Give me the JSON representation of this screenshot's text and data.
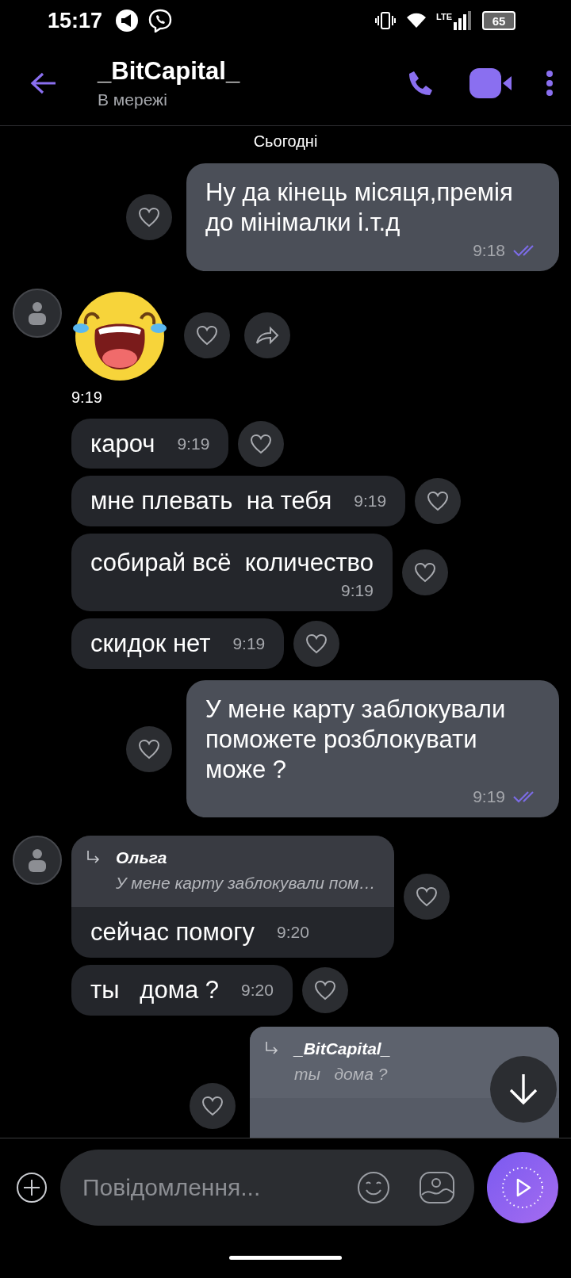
{
  "status_bar": {
    "time": "15:17",
    "network": "LTE",
    "battery": "65"
  },
  "header": {
    "title": "_BitCapital_",
    "subtitle": "В мережі"
  },
  "date_label": "Сьогодні",
  "messages": [
    {
      "kind": "text",
      "outgoing": true,
      "text": "Ну да кінець місяця,премія до мінімалки і.т.д",
      "time": "9:18",
      "read": true
    },
    {
      "kind": "sticker",
      "avatar": true,
      "time": "9:19"
    },
    {
      "kind": "text",
      "outgoing": false,
      "avatar": false,
      "text": "кароч",
      "time": "9:19",
      "time_below": false
    },
    {
      "kind": "text",
      "outgoing": false,
      "avatar": false,
      "text": "мне плевать  на тебя",
      "time": "9:19",
      "time_below": false
    },
    {
      "kind": "text",
      "outgoing": false,
      "avatar": false,
      "text": "собирай всё  количество",
      "time": "9:19",
      "time_below": true
    },
    {
      "kind": "text",
      "outgoing": false,
      "avatar": false,
      "text": "скидок нет",
      "time": "9:19",
      "time_below": false
    },
    {
      "kind": "text",
      "outgoing": true,
      "text": "У мене карту заблокували поможете розблокувати може ?",
      "time": "9:19",
      "read": true
    },
    {
      "kind": "reply",
      "outgoing": false,
      "avatar": true,
      "quote_author": "Ольга",
      "quote_text": "У мене карту заблокували пом…",
      "text": "сейчас помогу",
      "time": "9:20",
      "time_below": false
    },
    {
      "kind": "text",
      "outgoing": false,
      "avatar": false,
      "text": "ты   дома ?",
      "time": "9:20",
      "time_below": false
    },
    {
      "kind": "reply",
      "outgoing": true,
      "quote_author": "_BitCapital_",
      "quote_text": "ты   дома ?"
    }
  ],
  "composer": {
    "placeholder": "Повідомлення..."
  }
}
